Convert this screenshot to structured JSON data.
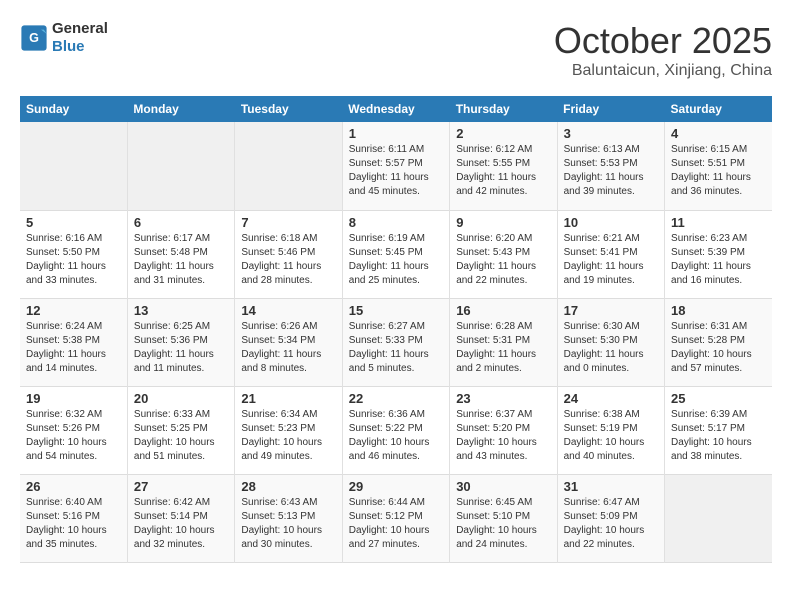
{
  "header": {
    "logo_line1": "General",
    "logo_line2": "Blue",
    "month": "October 2025",
    "location": "Baluntaicun, Xinjiang, China"
  },
  "days_of_week": [
    "Sunday",
    "Monday",
    "Tuesday",
    "Wednesday",
    "Thursday",
    "Friday",
    "Saturday"
  ],
  "weeks": [
    [
      {
        "day": "",
        "empty": true
      },
      {
        "day": "",
        "empty": true
      },
      {
        "day": "",
        "empty": true
      },
      {
        "day": "1",
        "sunrise": "6:11 AM",
        "sunset": "5:57 PM",
        "daylight": "11 hours and 45 minutes."
      },
      {
        "day": "2",
        "sunrise": "6:12 AM",
        "sunset": "5:55 PM",
        "daylight": "11 hours and 42 minutes."
      },
      {
        "day": "3",
        "sunrise": "6:13 AM",
        "sunset": "5:53 PM",
        "daylight": "11 hours and 39 minutes."
      },
      {
        "day": "4",
        "sunrise": "6:15 AM",
        "sunset": "5:51 PM",
        "daylight": "11 hours and 36 minutes."
      }
    ],
    [
      {
        "day": "5",
        "sunrise": "6:16 AM",
        "sunset": "5:50 PM",
        "daylight": "11 hours and 33 minutes."
      },
      {
        "day": "6",
        "sunrise": "6:17 AM",
        "sunset": "5:48 PM",
        "daylight": "11 hours and 31 minutes."
      },
      {
        "day": "7",
        "sunrise": "6:18 AM",
        "sunset": "5:46 PM",
        "daylight": "11 hours and 28 minutes."
      },
      {
        "day": "8",
        "sunrise": "6:19 AM",
        "sunset": "5:45 PM",
        "daylight": "11 hours and 25 minutes."
      },
      {
        "day": "9",
        "sunrise": "6:20 AM",
        "sunset": "5:43 PM",
        "daylight": "11 hours and 22 minutes."
      },
      {
        "day": "10",
        "sunrise": "6:21 AM",
        "sunset": "5:41 PM",
        "daylight": "11 hours and 19 minutes."
      },
      {
        "day": "11",
        "sunrise": "6:23 AM",
        "sunset": "5:39 PM",
        "daylight": "11 hours and 16 minutes."
      }
    ],
    [
      {
        "day": "12",
        "sunrise": "6:24 AM",
        "sunset": "5:38 PM",
        "daylight": "11 hours and 14 minutes."
      },
      {
        "day": "13",
        "sunrise": "6:25 AM",
        "sunset": "5:36 PM",
        "daylight": "11 hours and 11 minutes."
      },
      {
        "day": "14",
        "sunrise": "6:26 AM",
        "sunset": "5:34 PM",
        "daylight": "11 hours and 8 minutes."
      },
      {
        "day": "15",
        "sunrise": "6:27 AM",
        "sunset": "5:33 PM",
        "daylight": "11 hours and 5 minutes."
      },
      {
        "day": "16",
        "sunrise": "6:28 AM",
        "sunset": "5:31 PM",
        "daylight": "11 hours and 2 minutes."
      },
      {
        "day": "17",
        "sunrise": "6:30 AM",
        "sunset": "5:30 PM",
        "daylight": "11 hours and 0 minutes."
      },
      {
        "day": "18",
        "sunrise": "6:31 AM",
        "sunset": "5:28 PM",
        "daylight": "10 hours and 57 minutes."
      }
    ],
    [
      {
        "day": "19",
        "sunrise": "6:32 AM",
        "sunset": "5:26 PM",
        "daylight": "10 hours and 54 minutes."
      },
      {
        "day": "20",
        "sunrise": "6:33 AM",
        "sunset": "5:25 PM",
        "daylight": "10 hours and 51 minutes."
      },
      {
        "day": "21",
        "sunrise": "6:34 AM",
        "sunset": "5:23 PM",
        "daylight": "10 hours and 49 minutes."
      },
      {
        "day": "22",
        "sunrise": "6:36 AM",
        "sunset": "5:22 PM",
        "daylight": "10 hours and 46 minutes."
      },
      {
        "day": "23",
        "sunrise": "6:37 AM",
        "sunset": "5:20 PM",
        "daylight": "10 hours and 43 minutes."
      },
      {
        "day": "24",
        "sunrise": "6:38 AM",
        "sunset": "5:19 PM",
        "daylight": "10 hours and 40 minutes."
      },
      {
        "day": "25",
        "sunrise": "6:39 AM",
        "sunset": "5:17 PM",
        "daylight": "10 hours and 38 minutes."
      }
    ],
    [
      {
        "day": "26",
        "sunrise": "6:40 AM",
        "sunset": "5:16 PM",
        "daylight": "10 hours and 35 minutes."
      },
      {
        "day": "27",
        "sunrise": "6:42 AM",
        "sunset": "5:14 PM",
        "daylight": "10 hours and 32 minutes."
      },
      {
        "day": "28",
        "sunrise": "6:43 AM",
        "sunset": "5:13 PM",
        "daylight": "10 hours and 30 minutes."
      },
      {
        "day": "29",
        "sunrise": "6:44 AM",
        "sunset": "5:12 PM",
        "daylight": "10 hours and 27 minutes."
      },
      {
        "day": "30",
        "sunrise": "6:45 AM",
        "sunset": "5:10 PM",
        "daylight": "10 hours and 24 minutes."
      },
      {
        "day": "31",
        "sunrise": "6:47 AM",
        "sunset": "5:09 PM",
        "daylight": "10 hours and 22 minutes."
      },
      {
        "day": "",
        "empty": true
      }
    ]
  ],
  "labels": {
    "sunrise": "Sunrise:",
    "sunset": "Sunset:",
    "daylight": "Daylight:"
  }
}
